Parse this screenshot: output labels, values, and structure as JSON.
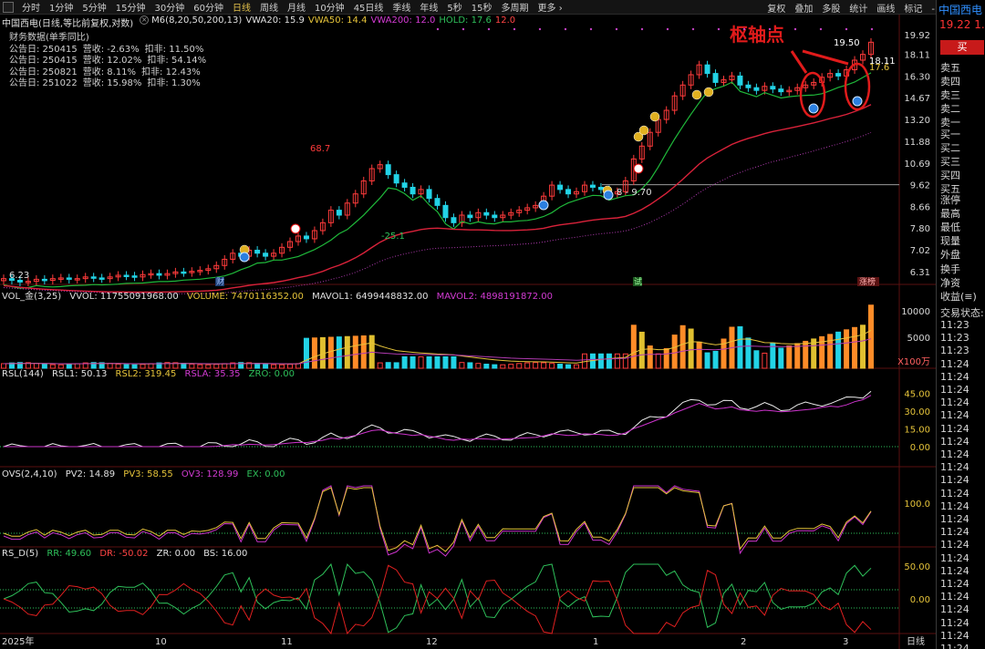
{
  "toolbar": {
    "periods": [
      "分时",
      "1分钟",
      "5分钟",
      "15分钟",
      "30分钟",
      "60分钟",
      "日线",
      "周线",
      "月线",
      "10分钟",
      "45日线",
      "季线",
      "年线",
      "5秒",
      "15秒",
      "多周期",
      "更多 ›"
    ],
    "active": "日线",
    "actions": [
      "复权",
      "叠加",
      "多股",
      "统计",
      "画线",
      "标记",
      "-自选",
      "返回"
    ]
  },
  "main_header": {
    "name": "中国西电(日线,等比前复权,对数)",
    "indicator": "M6(8,20,50,200,13)",
    "vwa20": "VWA20: 15.9",
    "vwa50": "VWA50: 14.4",
    "vwa200": "VWA200: 12.0",
    "hold": "HOLD: 17.6",
    "extra": "12.0"
  },
  "fin": {
    "title": "财务数据(单季同比)",
    "rows": [
      {
        "date": "公告日: 250415",
        "rev": "营收: -2.63%",
        "net": "扣非: 11.50%"
      },
      {
        "date": "公告日: 250415",
        "rev": "营收: 12.02%",
        "net": "扣非: 54.14%"
      },
      {
        "date": "公告日: 250821",
        "rev": "营收: 8.11%",
        "net": "扣非: 12.43%"
      },
      {
        "date": "公告日: 251022",
        "rev": "营收: 15.98%",
        "net": "扣非: 1.30%"
      }
    ]
  },
  "annotation": "枢轴点",
  "price_axis": [
    "19.92",
    "18.11",
    "16.30",
    "14.67",
    "13.20",
    "11.88",
    "10.69",
    "9.62",
    "8.66",
    "7.80",
    "7.02",
    "6.31"
  ],
  "price_labels": {
    "high": "19.50",
    "current": "18.11",
    "hold": "17.6",
    "p687": "68.7",
    "p251": "-25.1",
    "range": "8 - 9.70",
    "low": "6.23"
  },
  "markers": {
    "cai": "财",
    "shi": "试",
    "zhangting": "涨榜",
    "dot_s": "$"
  },
  "vol_header": {
    "name": "VOL_金(3,25)",
    "vvol": "VVOL: 11755091968.00",
    "volume": "VOLUME: 7470116352.00",
    "mavol1": "MAVOL1: 6499448832.00",
    "mavol2": "MAVOL2: 4898191872.00"
  },
  "vol_axis": [
    "10000",
    "5000",
    "X100万"
  ],
  "rsl_header": {
    "name": "RSL(144)",
    "rsl1": "RSL1: 50.13",
    "rsl2": "RSL2: 319.45",
    "rsla": "RSLA: 35.35",
    "zro": "ZRO: 0.00"
  },
  "rsl_axis": [
    "45.00",
    "30.00",
    "15.00",
    "0.00"
  ],
  "ovs_header": {
    "name": "OVS(2,4,10)",
    "pv2": "PV2: 14.89",
    "pv3": "PV3: 58.55",
    "ov3": "OV3: 128.99",
    "ex": "EX: 0.00"
  },
  "ovs_axis": [
    "100.0"
  ],
  "rsd_header": {
    "name": "RS_D(5)",
    "rr": "RR: 49.60",
    "dr": "DR: -50.02",
    "zr": "ZR: 0.00",
    "bs": "BS: 16.00"
  },
  "rsd_axis": [
    "50.00",
    "0.00"
  ],
  "time_axis": [
    "2025年",
    "10",
    "11",
    "12",
    "1",
    "2",
    "3",
    "日线"
  ],
  "right_panel": {
    "name": "中国西电",
    "price": "19.22",
    "price_extra": "1.",
    "buy": "买",
    "ask": [
      "卖五",
      "卖四",
      "卖三",
      "卖二",
      "卖一"
    ],
    "bid": [
      "买一",
      "买二",
      "买三",
      "买四",
      "买五"
    ],
    "stats": [
      "涨停",
      "最高",
      "最低",
      "现量",
      "外盘"
    ],
    "stats2": [
      "换手",
      "净资",
      "收益(≡)"
    ],
    "status": "交易状态: 2",
    "times": [
      "11:23",
      "11:23",
      "11:23",
      "11:24",
      "11:24",
      "11:24",
      "11:24",
      "11:24",
      "11:24",
      "11:24",
      "11:24",
      "11:24",
      "11:24",
      "11:24",
      "11:24",
      "11:24",
      "11:24",
      "11:24",
      "11:24",
      "11:24",
      "11:24",
      "11:24",
      "11:24",
      "11:24",
      "11:24",
      "11:24",
      "11:25",
      "11:25"
    ]
  },
  "colors": {
    "up": "#ff3b3b",
    "down": "#22d3e6",
    "ma_green": "#1fb83a",
    "ma_red": "#d9223a",
    "white": "#e8e8e8",
    "magenta": "#cc33cc",
    "yellow": "#e0c030",
    "orange": "#ff8c28"
  },
  "chart_data": {
    "type": "candlestick",
    "price_series_close": [
      6.1,
      6.05,
      6.0,
      6.02,
      6.08,
      6.05,
      6.1,
      6.12,
      6.08,
      6.1,
      6.15,
      6.12,
      6.1,
      6.15,
      6.2,
      6.18,
      6.15,
      6.22,
      6.25,
      6.2,
      6.25,
      6.3,
      6.28,
      6.32,
      6.35,
      6.4,
      6.5,
      6.7,
      6.9,
      6.8,
      7.0,
      6.9,
      6.8,
      6.9,
      7.1,
      7.3,
      7.5,
      7.4,
      7.7,
      8.0,
      8.5,
      8.3,
      8.8,
      9.2,
      9.8,
      10.4,
      10.6,
      10.1,
      9.7,
      9.5,
      9.2,
      9.4,
      9.0,
      8.7,
      8.2,
      8.0,
      8.3,
      8.2,
      8.4,
      8.3,
      8.2,
      8.3,
      8.4,
      8.5,
      8.6,
      8.7,
      9.1,
      9.6,
      9.4,
      9.2,
      9.3,
      9.6,
      9.5,
      9.4,
      9.2,
      9.3,
      9.8,
      10.9,
      11.6,
      12.4,
      13.2,
      13.8,
      14.8,
      15.6,
      16.4,
      17.2,
      16.5,
      15.8,
      16.0,
      16.3,
      15.6,
      15.4,
      15.2,
      15.5,
      15.3,
      15.1,
      15.2,
      15.4,
      15.6,
      15.8,
      16.2,
      16.5,
      16.3,
      16.8,
      17.6,
      18.1,
      19.2
    ],
    "ma_green": "step trend line",
    "ma_red": "long average"
  }
}
